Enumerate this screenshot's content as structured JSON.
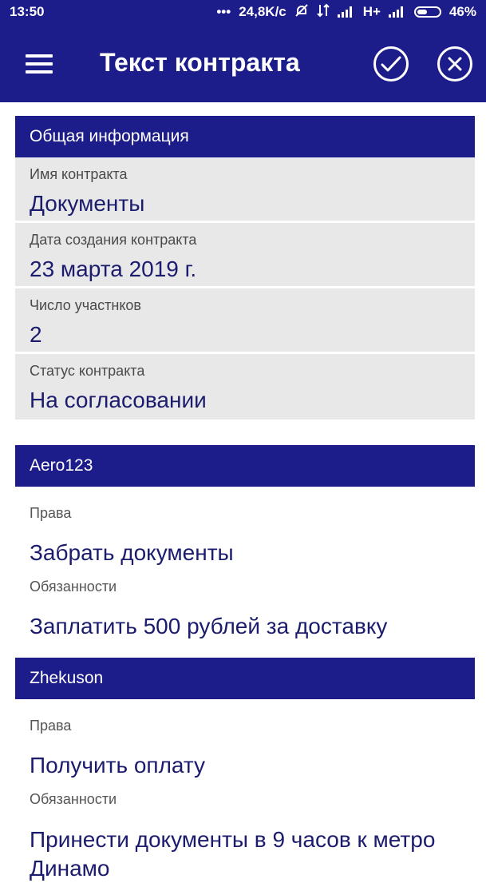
{
  "status_bar": {
    "time": "13:50",
    "network_speed": "24,8K/c",
    "network_type": "H+",
    "battery_percent": "46%",
    "battery_level": 0.46,
    "icons": [
      "more-dots-icon",
      "alarm-off-icon",
      "data-transfer-icon",
      "signal-icon",
      "signal-icon",
      "battery-icon"
    ]
  },
  "app_bar": {
    "title": "Текст контракта",
    "icons": [
      "menu-icon",
      "check-icon",
      "close-icon"
    ]
  },
  "general": {
    "header": "Общая информация",
    "fields": [
      {
        "label": "Имя контракта",
        "value": "Документы"
      },
      {
        "label": "Дата создания контракта",
        "value": "23 марта 2019 г."
      },
      {
        "label": "Число участнков",
        "value": "2"
      },
      {
        "label": "Статус контракта",
        "value": "На согласовании"
      }
    ]
  },
  "parties": [
    {
      "name": "Aero123",
      "rights_label": "Права",
      "rights": "Забрать документы",
      "duties_label": "Обязанности",
      "duties": "Заплатить 500 рублей за доставку"
    },
    {
      "name": "Zhekuson",
      "rights_label": "Права",
      "rights": "Получить оплату",
      "duties_label": "Обязанности",
      "duties": "Принести документы в 9 часов к метро Динамо"
    }
  ],
  "colors": {
    "primary": "#1c1c8a",
    "info_background": "#e8e8e8",
    "value_text": "#1c1c6e",
    "label_text": "#4a4a4a"
  }
}
